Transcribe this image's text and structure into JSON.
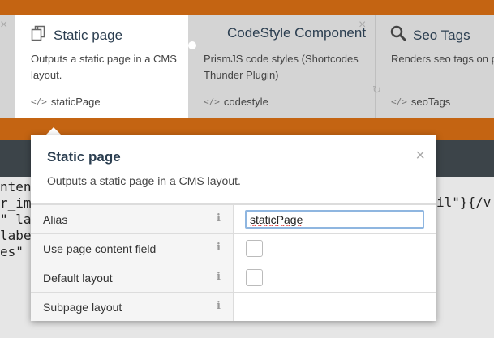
{
  "components": [
    {
      "name": "",
      "description": "",
      "alias": ""
    },
    {
      "name": "Static page",
      "description": "Outputs a static page in a CMS layout.",
      "alias": "staticPage",
      "icon": "copy-icon"
    },
    {
      "name": "CodeStyle Component",
      "description": "PrismJS code styles (Shortcodes Thunder Plugin)",
      "alias": "codestyle",
      "icon": "none"
    },
    {
      "name": "Seo Tags",
      "description": "Renders seo tags on page.",
      "alias": "seoTags",
      "icon": "search-icon"
    }
  ],
  "code_fragments": [
    "nten",
    "r_im",
    "\" la",
    "labe",
    "es\""
  ],
  "code_right": "il\"}{/v",
  "popup": {
    "title": "Static page",
    "description": "Outputs a static page in a CMS layout.",
    "close": "×",
    "properties": [
      {
        "label": "Alias",
        "value": "staticPage",
        "type": "text"
      },
      {
        "label": "Use page content field",
        "type": "checkbox"
      },
      {
        "label": "Default layout",
        "type": "checkbox"
      },
      {
        "label": "Subpage layout",
        "type": "dropdown"
      }
    ]
  },
  "colors": {
    "accent": "#c46412",
    "dark": "#3c4449"
  }
}
